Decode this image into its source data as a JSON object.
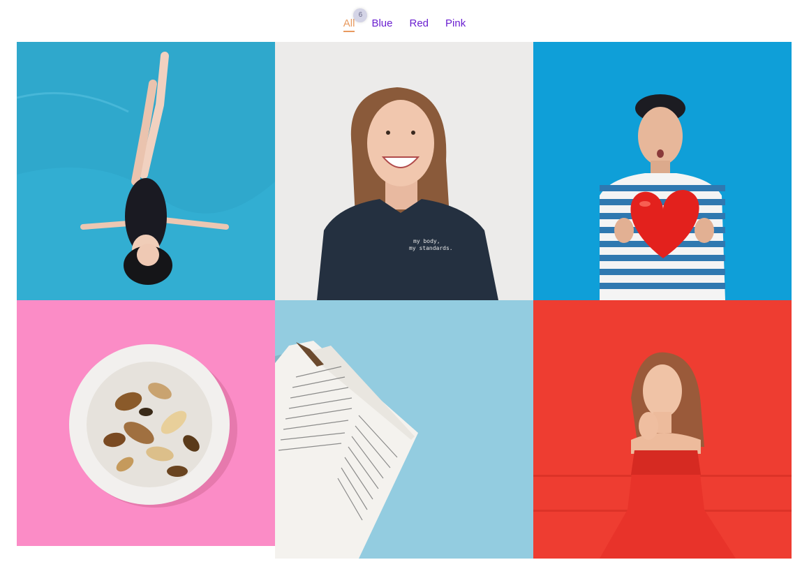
{
  "filters": [
    {
      "label": "All",
      "active": true,
      "count": "6"
    },
    {
      "label": "Blue",
      "active": false
    },
    {
      "label": "Red",
      "active": false
    },
    {
      "label": "Pink",
      "active": false
    }
  ],
  "gallery": {
    "items": [
      {
        "category": "Blue",
        "subject": "woman floating in pool",
        "background": "#2fa8cc"
      },
      {
        "category": "",
        "subject": "smiling woman in navy t-shirt",
        "background": "#ecebea",
        "shirt_text": [
          "my body,",
          "my standards."
        ]
      },
      {
        "category": "Blue",
        "subject": "man holding red heart balloon",
        "background": "#0f9fd8"
      },
      {
        "category": "Pink",
        "subject": "plate of mushrooms",
        "background": "#fb8cc6"
      },
      {
        "category": "Blue",
        "subject": "open book",
        "background": "#93cce0"
      },
      {
        "category": "Red",
        "subject": "woman in red dress",
        "background": "#ee3d31"
      }
    ]
  },
  "colors": {
    "accent_active": "#e89a5f",
    "link": "#6a1fd0",
    "badge_bg": "#d4d4e6"
  }
}
